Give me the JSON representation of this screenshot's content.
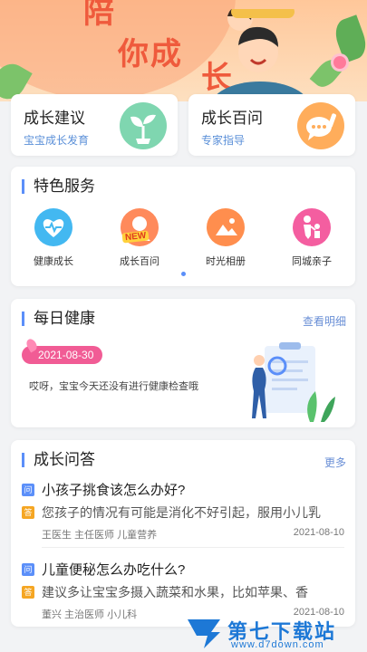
{
  "banner": {
    "slogan_line1": "陪",
    "slogan_line2": "你成",
    "slogan_line3": "长",
    "colors": {
      "bg": "#fde0c0",
      "accent": "#ef5a3c"
    }
  },
  "top_cards": [
    {
      "title": "成长建议",
      "subtitle": "宝宝成长发育",
      "icon": "sprout-icon",
      "color": "#7fd6b0"
    },
    {
      "title": "成长百问",
      "subtitle": "专家指导",
      "icon": "chat-bubble-icon",
      "color": "#ffad5b"
    }
  ],
  "services": {
    "title": "特色服务",
    "items": [
      {
        "label": "健康成长",
        "icon": "heartbeat-icon",
        "color": "#43b8f1"
      },
      {
        "label": "成长百问",
        "icon": "child-avatar-icon",
        "color": "#ff8a5b",
        "badge": "NEW"
      },
      {
        "label": "时光相册",
        "icon": "photo-album-icon",
        "color": "#ff8e4e"
      },
      {
        "label": "同城亲子",
        "icon": "parent-child-icon",
        "color": "#f45ea0"
      }
    ]
  },
  "daily_health": {
    "title": "每日健康",
    "more": "查看明细",
    "date": "2021-08-30",
    "message": "哎呀，宝宝今天还没有进行健康检查哦"
  },
  "qa": {
    "title": "成长问答",
    "more": "更多",
    "q_badge": "问",
    "a_badge": "答",
    "items": [
      {
        "question": "小孩子挑食该怎么办好?",
        "answer": "您孩子的情况有可能是消化不好引起，服用小儿乳",
        "meta": "王医生 主任医师 儿童营养",
        "date": "2021-08-10"
      },
      {
        "question": "儿童便秘怎么办吃什么?",
        "answer": "建议多让宝宝多摄入蔬菜和水果，比如苹果、香",
        "meta": "董兴 主治医师 小儿科",
        "date": "2021-08-10"
      }
    ]
  },
  "watermark": {
    "name": "第七下载站",
    "url": "www.d7down.com"
  }
}
